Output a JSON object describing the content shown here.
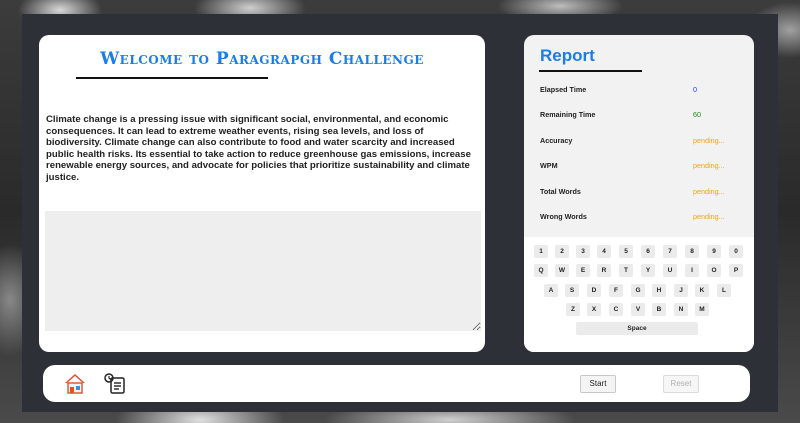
{
  "main": {
    "title": "Welcome to Paragrapgh Challenge",
    "paragraph": "Climate change is a pressing issue with significant social, environmental, and economic consequences. It can lead to extreme weather events, rising sea levels, and loss of biodiversity. Climate change can also contribute to food and water scarcity and increased public health risks. Its essential to take action to reduce greenhouse gas emissions, increase renewable energy sources, and advocate for policies that prioritize sustainability and climate justice.",
    "typing_area_value": ""
  },
  "report": {
    "title": "Report",
    "stats": [
      {
        "label": "Elapsed Time",
        "value": "0",
        "color": "#1a3cff"
      },
      {
        "label": "Remaining Time",
        "value": "60",
        "color": "#1a8a1a"
      },
      {
        "label": "Accuracy",
        "value": "pending...",
        "color": "#f0a020"
      },
      {
        "label": "WPM",
        "value": "pending...",
        "color": "#f0a020"
      },
      {
        "label": "Total Words",
        "value": "pending...",
        "color": "#f0a020"
      },
      {
        "label": "Wrong Words",
        "value": "pending...",
        "color": "#f0a020"
      }
    ]
  },
  "keyboard": {
    "rows": [
      [
        "1",
        "2",
        "3",
        "4",
        "5",
        "6",
        "7",
        "8",
        "9",
        "0"
      ],
      [
        "Q",
        "W",
        "E",
        "R",
        "T",
        "Y",
        "U",
        "I",
        "O",
        "P"
      ],
      [
        "A",
        "S",
        "D",
        "F",
        "G",
        "H",
        "J",
        "K",
        "L"
      ],
      [
        "Z",
        "X",
        "C",
        "V",
        "B",
        "N",
        "M"
      ]
    ],
    "space_label": "Space"
  },
  "bottom_bar": {
    "home_icon": "home-icon",
    "history_icon": "task-list-icon",
    "start_label": "Start",
    "reset_label": "Reset"
  },
  "colors": {
    "accent": "#1a7de8",
    "frame": "#2e3038"
  }
}
